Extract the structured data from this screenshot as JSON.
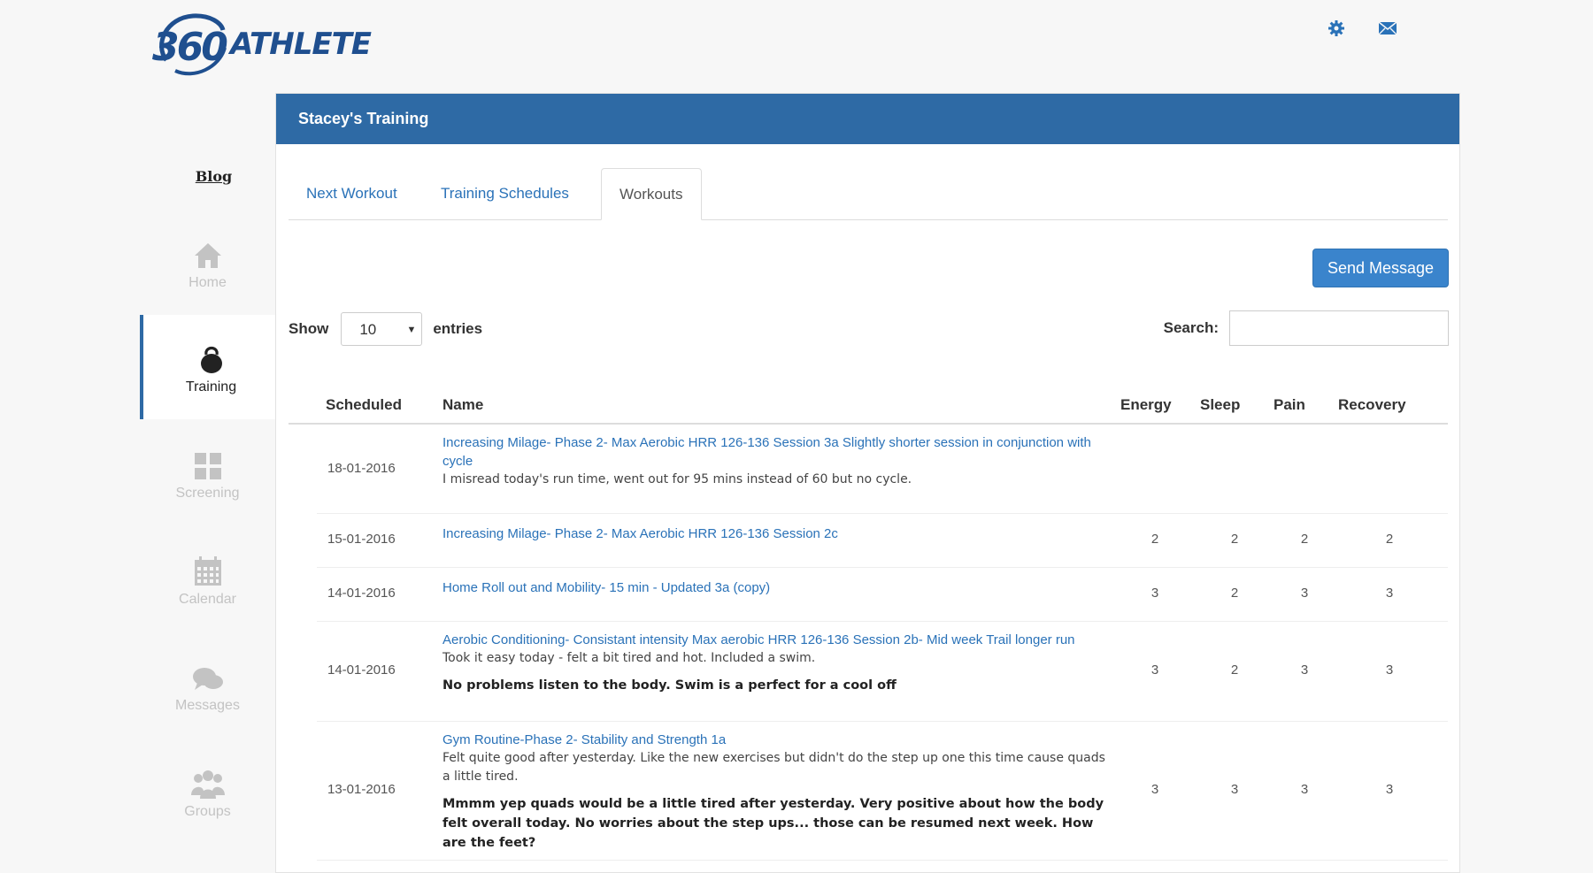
{
  "brand": {
    "logo_number": "360",
    "logo_word": "ATHLETE"
  },
  "header_icons": [
    "gear-icon",
    "mail-icon"
  ],
  "sidebar": {
    "blog_label": "Blog",
    "items": [
      {
        "label": "Home",
        "icon": "home-icon"
      },
      {
        "label": "Training",
        "icon": "kettlebell-icon",
        "active": true
      },
      {
        "label": "Screening",
        "icon": "grid-icon"
      },
      {
        "label": "Calendar",
        "icon": "calendar-icon"
      },
      {
        "label": "Messages",
        "icon": "chat-icon"
      },
      {
        "label": "Groups",
        "icon": "group-icon"
      }
    ]
  },
  "panel": {
    "title": "Stacey's Training"
  },
  "tabs": [
    {
      "label": "Next Workout"
    },
    {
      "label": "Training Schedules"
    },
    {
      "label": "Workouts",
      "active": true
    }
  ],
  "send_message_label": "Send Message",
  "entries": {
    "show_label": "Show",
    "selected": "10",
    "suffix": "entries"
  },
  "search": {
    "label": "Search:",
    "value": ""
  },
  "table": {
    "headers": [
      "Scheduled",
      "Name",
      "Energy",
      "Sleep",
      "Pain",
      "Recovery"
    ],
    "rows": [
      {
        "date": "18-01-2016",
        "name": "Increasing Milage- Phase 2- Max Aerobic HRR 126-136 Session 3a Slightly shorter session in conjunction with cycle",
        "note": "I misread today's run time, went out for 95 mins instead of 60 but no cycle.",
        "reply": "",
        "energy": "",
        "sleep": "",
        "pain": "",
        "recovery": ""
      },
      {
        "date": "15-01-2016",
        "name": "Increasing Milage- Phase 2- Max Aerobic HRR 126-136 Session 2c",
        "note": "",
        "reply": "",
        "energy": "2",
        "sleep": "2",
        "pain": "2",
        "recovery": "2"
      },
      {
        "date": "14-01-2016",
        "name": "Home Roll out and Mobility- 15 min - Updated 3a (copy)",
        "note": "",
        "reply": "",
        "energy": "3",
        "sleep": "2",
        "pain": "3",
        "recovery": "3"
      },
      {
        "date": "14-01-2016",
        "name": "Aerobic Conditioning- Consistant intensity Max aerobic HRR 126-136 Session 2b- Mid week Trail longer run",
        "note": "Took it easy today - felt a bit tired and hot. Included a swim.",
        "reply": "No problems listen to the body. Swim is a perfect for a cool off",
        "energy": "3",
        "sleep": "2",
        "pain": "3",
        "recovery": "3"
      },
      {
        "date": "13-01-2016",
        "name": "Gym Routine-Phase 2- Stability and Strength 1a",
        "note": "Felt quite good after yesterday. Like the new exercises but didn't do the step up one this time cause quads a little tired.",
        "reply": "Mmmm yep quads would be a little tired after yesterday. Very positive about how the body felt overall today. No worries about the step ups... those can be resumed next week. How are the feet?",
        "energy": "3",
        "sleep": "3",
        "pain": "3",
        "recovery": "3"
      }
    ]
  }
}
